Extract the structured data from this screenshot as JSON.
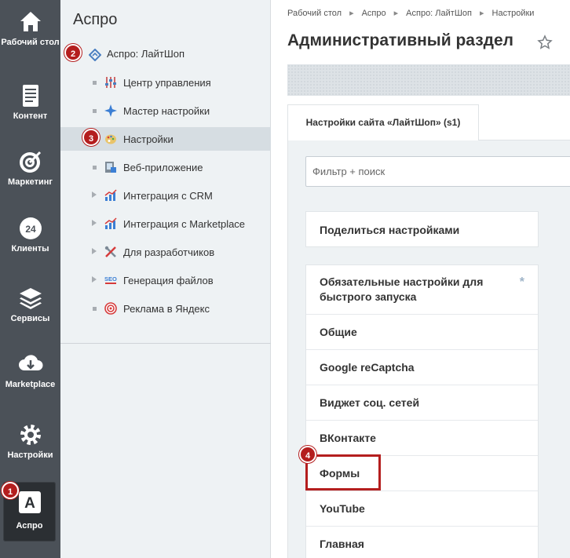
{
  "rail": {
    "items": [
      {
        "label": "Рабочий стол",
        "icon": "home-icon"
      },
      {
        "label": "Контент",
        "icon": "document-icon"
      },
      {
        "label": "Маркетинг",
        "icon": "target-icon"
      },
      {
        "label": "Клиенты",
        "icon": "clients-24-icon"
      },
      {
        "label": "Сервисы",
        "icon": "layers-icon"
      },
      {
        "label": "Marketplace",
        "icon": "cloud-download-icon"
      },
      {
        "label": "Настройки",
        "icon": "gear-icon"
      },
      {
        "label": "Аспро",
        "icon": "aspro-a-icon"
      }
    ],
    "badge_1": "1"
  },
  "menu": {
    "title": "Аспро",
    "root": {
      "label": "Аспро: ЛайтШоп",
      "icon": "aspro-diamond-icon",
      "badge": "2"
    },
    "items": [
      {
        "label": "Центр управления",
        "icon": "sliders-icon"
      },
      {
        "label": "Мастер настройки",
        "icon": "sparkle-icon"
      },
      {
        "label": "Настройки",
        "icon": "palette-icon",
        "badge": "3"
      },
      {
        "label": "Веб-приложение",
        "icon": "web-app-icon"
      },
      {
        "label": "Интеграция с CRM",
        "icon": "chart-icon"
      },
      {
        "label": "Интеграция с Marketplace",
        "icon": "chart-icon"
      },
      {
        "label": "Для разработчиков",
        "icon": "tools-icon"
      },
      {
        "label": "Генерация файлов",
        "icon": "seo-icon"
      },
      {
        "label": "Реклама в Яндекс",
        "icon": "target-red-icon"
      }
    ]
  },
  "main": {
    "breadcrumbs": [
      "Рабочий стол",
      "Аспро",
      "Аспро: ЛайтШоп",
      "Настройки"
    ],
    "title": "Административный раздел",
    "tab": "Настройки сайта «ЛайтШоп» (s1)",
    "filter_placeholder": "Фильтр + поиск",
    "share": "Поделиться настройками",
    "settings": [
      {
        "label": "Обязательные настройки для быстрого запуска",
        "required": "*"
      },
      {
        "label": "Общие"
      },
      {
        "label": "Google reCaptcha"
      },
      {
        "label": "Виджет соц. сетей"
      },
      {
        "label": "ВКонтакте"
      },
      {
        "label": "Формы",
        "badge": "4"
      },
      {
        "label": "YouTube"
      },
      {
        "label": "Главная"
      }
    ]
  },
  "colors": {
    "rail": "#4b5158",
    "menu": "#eef2f4",
    "badge": "#b41e1e"
  }
}
